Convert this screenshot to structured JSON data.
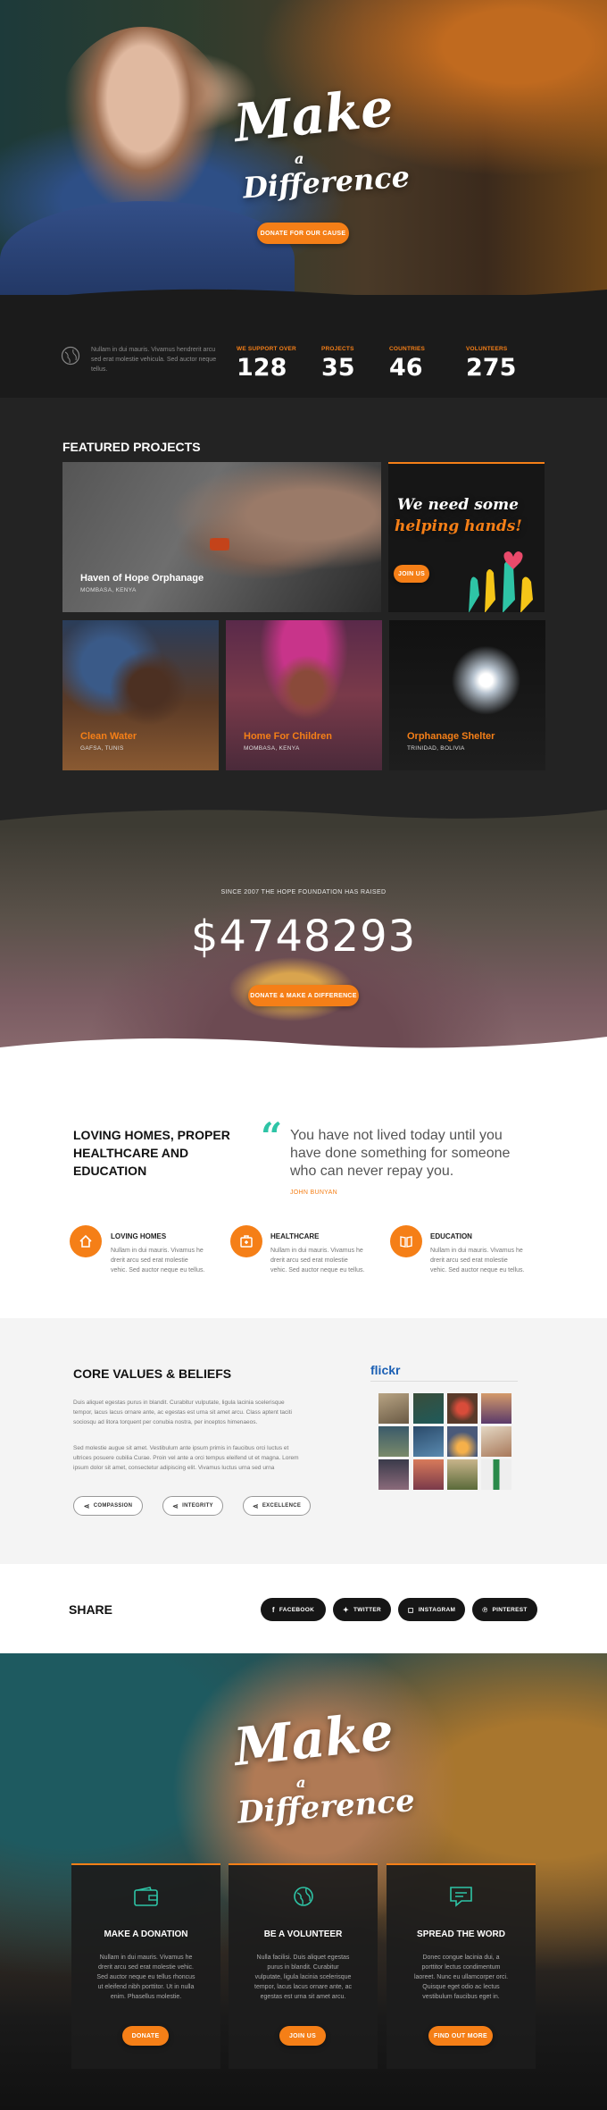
{
  "hero": {
    "line1": "Make",
    "line2": "a",
    "line3": "Difference",
    "button": "DONATE FOR OUR CAUSE"
  },
  "stats": {
    "intro": "Nullam in dui mauris. Vivamus hendrerit arcu sed erat molestie vehicula. Sed auctor neque tellus.",
    "items": [
      {
        "label": "WE SUPPORT OVER",
        "value": "128"
      },
      {
        "label": "PROJECTS",
        "value": "35"
      },
      {
        "label": "COUNTRIES",
        "value": "46"
      },
      {
        "label": "VOLUNTEERS",
        "value": "275"
      }
    ]
  },
  "featured": {
    "heading": "FEATURED PROJECTS",
    "projects": [
      {
        "title": "Haven of Hope Orphanage",
        "location": "MOMBASA, KENYA"
      },
      {
        "title": "Clean Water",
        "location": "GAFSA, TUNIS"
      },
      {
        "title": "Home For Children",
        "location": "MOMBASA, KENYA"
      },
      {
        "title": "Orphanage Shelter",
        "location": "TRINIDAD, BOLIVIA"
      }
    ],
    "promo": {
      "line1": "We need some",
      "line2": "helping hands!",
      "button": "JOIN US"
    }
  },
  "funds": {
    "caption": "SINCE 2007 THE HOPE FOUNDATION HAS RAISED",
    "amount": "$4748293",
    "button": "DONATE & MAKE A DIFFERENCE"
  },
  "loving": {
    "heading_line1": "LOVING HOMES, PROPER",
    "heading_line2": "HEALTHCARE AND",
    "heading_line3": "EDUCATION",
    "quote_line1": "You have not lived today until you",
    "quote_line2": "have done something for someone",
    "quote_line3": "who can never repay you.",
    "quote_author": "JOHN BUNYAN",
    "features": [
      {
        "title": "LOVING HOMES",
        "l1": "Nullam in dui mauris. Vivamus he",
        "l2": "drerit arcu sed erat molestie",
        "l3": "vehic. Sed auctor neque eu tellus."
      },
      {
        "title": "HEALTHCARE",
        "l1": "Nullam in dui mauris. Vivamus he",
        "l2": "drerit arcu sed erat molestie",
        "l3": "vehic. Sed auctor neque eu tellus."
      },
      {
        "title": "EDUCATION",
        "l1": "Nullam in dui mauris. Vivamus he",
        "l2": "drerit arcu sed erat molestie",
        "l3": "vehic. Sed auctor neque eu tellus."
      }
    ]
  },
  "core": {
    "heading": "CORE VALUES & BELIEFS",
    "p1_l1": "Duis aliquet egestas purus in blandit. Curabitur vulputate, ligula lacinia scelerisque",
    "p1_l2": "tempor, lacus lacus ornare ante, ac egestas est urna sit amet arcu. Class aptent taciti",
    "p1_l3": "sociosqu ad litora torquent per conubia nostra, per inceptos himenaeos.",
    "p2_l1": "Sed molestie augue sit amet. Vestibulum ante ipsum primis in faucibus orci luctus et",
    "p2_l2": "ultrices posuere cubilia Curae. Proin vel ante a orci tempus eleifend ut et magna. Lorem",
    "p2_l3": "ipsum dolor sit amet, consectetur adipiscing elit. Vivamus luctus urna sed urna",
    "pills": [
      "COMPASSION",
      "INTEGRITY",
      "EXCELLENCE"
    ],
    "flickr": "flickr"
  },
  "share": {
    "heading": "SHARE",
    "buttons": [
      "FACEBOOK",
      "TWITTER",
      "INSTAGRAM",
      "PINTEREST"
    ]
  },
  "bottom": {
    "line1": "Make",
    "line2": "a",
    "line3": "Difference",
    "cards": [
      {
        "title": "MAKE A DONATION",
        "l1": "Nullam in dui mauris. Vivamus he",
        "l2": "drerit arcu sed erat molestie vehic.",
        "l3": "Sed auctor neque eu tellus rhoncus",
        "l4": "ut eleifend nibh porttitor. Ut in nulla",
        "l5": "enim. Phasellus molestie.",
        "button": "DONATE"
      },
      {
        "title": "BE A VOLUNTEER",
        "l1": "Nulla facilisi. Duis aliquet egestas",
        "l2": "purus in blandit. Curabitur",
        "l3": "vulputate, ligula lacinia scelerisque",
        "l4": "tempor, lacus lacus ornare ante, ac",
        "l5": "egestas est urna sit amet arcu.",
        "button": "JOIN US"
      },
      {
        "title": "SPREAD THE WORD",
        "l1": "Donec congue lacinia dui, a",
        "l2": "porttitor lectus condimentum",
        "l3": "laoreet. Nunc eu ullamcorper orci.",
        "l4": "Quisque eget odio ac lectus",
        "l5": "vestibulum faucibus eget in.",
        "button": "FIND OUT MORE"
      }
    ]
  },
  "colors": {
    "accent": "#f57f17",
    "dark": "#1b1b1b",
    "teal": "#2ec4a6"
  }
}
